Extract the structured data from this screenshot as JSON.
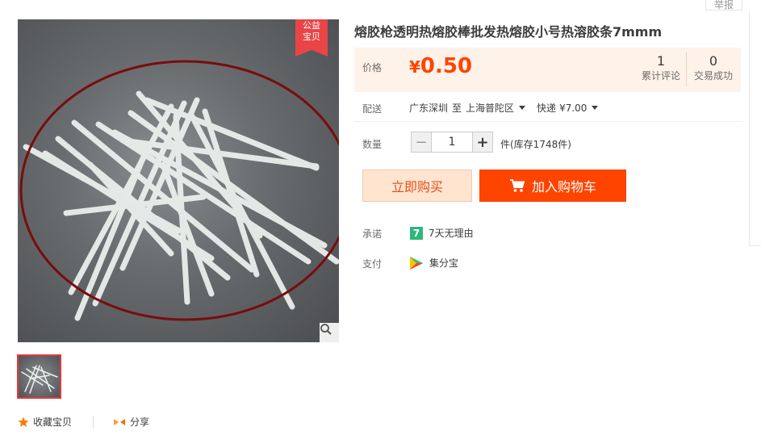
{
  "report": "举报",
  "badge": {
    "line1": "公益",
    "line2": "宝贝"
  },
  "icons": {
    "zoom": "magnifier-icon",
    "star": "star-icon",
    "share": "share-icon",
    "cart": "cart-icon",
    "promise": "seven-day-icon",
    "pay": "jifenbao-icon"
  },
  "actions": {
    "favorite": "收藏宝贝",
    "share": "分享"
  },
  "product": {
    "title": "熔胶枪透明热熔胶棒批发热熔胶小号热溶胶条7mmm"
  },
  "price": {
    "label": "价格",
    "currency": "¥",
    "value": "0.50"
  },
  "stats": {
    "reviews_count": "1",
    "reviews_label": "累计评论",
    "trades_count": "0",
    "trades_label": "交易成功"
  },
  "shipping": {
    "label": "配送",
    "from": "广东深圳",
    "to_word": "至",
    "to": "上海普陀区",
    "method": "快递",
    "fee": "¥7.00"
  },
  "quantity": {
    "label": "数量",
    "value": "1",
    "minus": "−",
    "plus": "+",
    "unit_stock": "件(库存1748件)"
  },
  "buttons": {
    "buy_now": "立即购买",
    "add_to_cart": "加入购物车"
  },
  "promise": {
    "label": "承诺",
    "icon_text": "7",
    "text": "7天无理由"
  },
  "payment": {
    "label": "支付",
    "text": "集分宝"
  },
  "colors": {
    "accent": "#ff4400",
    "price_bg": "#fff2e8",
    "badge": "#e94446",
    "thumb_border": "#e4393c",
    "promise_green": "#2fb67c"
  }
}
